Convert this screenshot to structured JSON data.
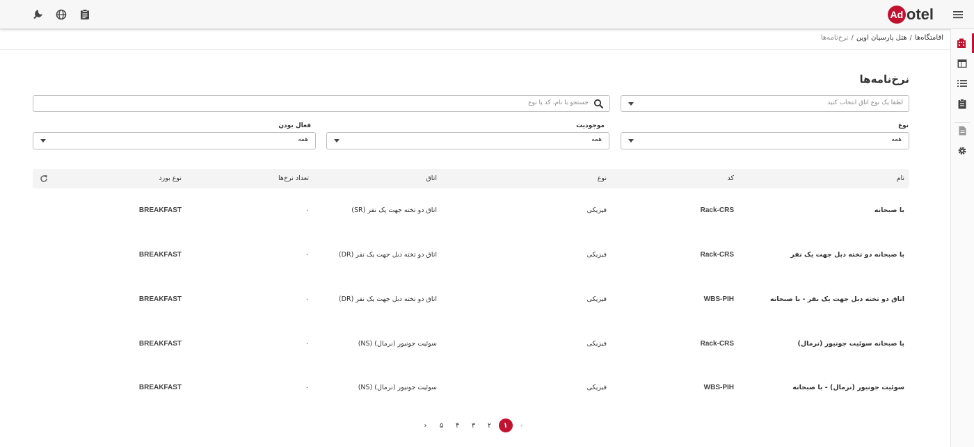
{
  "brand": {
    "name": "Adotel",
    "logo_mark": "Ad",
    "logo_rest": "otel",
    "accent": "#c1122f"
  },
  "topbar": {
    "icons": [
      "theme-toggle-icon",
      "globe-icon",
      "clipboard-icon"
    ],
    "menu_icon": "hamburger-menu-icon"
  },
  "sidebar": {
    "items": [
      "hotel-building-icon",
      "table-layout-icon",
      "list-icon",
      "clipboard-list-icon",
      "document-icon",
      "settings-gear-icon"
    ]
  },
  "breadcrumb": {
    "item1": "اقامتگاه‌ها",
    "sep": "/",
    "item2": "هتل پارسیان اوین",
    "current": "نرخ‌نامه‌ها"
  },
  "page_title": "نرخ‌نامه‌ها",
  "filters": {
    "room_type_placeholder": "لطفا یک نوع اتاق انتخاب کنید",
    "search_placeholder": "جستجو با نام، کد یا نوع",
    "type_label": "نوع",
    "type_value": "همه",
    "availability_label": "موجودیت",
    "availability_value": "همه",
    "active_label": "فعال بودن",
    "active_value": "همه"
  },
  "table": {
    "headers": {
      "name": "نام",
      "code": "کد",
      "type": "نوع",
      "room": "اتاق",
      "rate_count": "تعداد نرخ‌ها",
      "board_type": "نوع بورد"
    },
    "rows": [
      {
        "name": "با صبحانه",
        "code": "Rack-CRS",
        "type": "فیزیکی",
        "room": "اتاق دو تخته جهت یک نفر (SR)",
        "rate_count": "۰",
        "board_type": "BREAKFAST"
      },
      {
        "name": "با صبحانه دو تخته دبل جهت یک نفر",
        "code": "Rack-CRS",
        "type": "فیزیکی",
        "room": "اتاق دو تخته دبل جهت یک نفر (DR)",
        "rate_count": "۰",
        "board_type": "BREAKFAST"
      },
      {
        "name": "اتاق دو تخته دبل جهت یک نفر - با صبحانه",
        "code": "WBS-PIH",
        "type": "فیزیکی",
        "room": "اتاق دو تخته دبل جهت یک نفر (DR)",
        "rate_count": "۰",
        "board_type": "BREAKFAST"
      },
      {
        "name": "با صبحانه سوئیت جونیور (نرمال)",
        "code": "Rack-CRS",
        "type": "فیزیکی",
        "room": "سوئیت جونیور (نرمال) (NS)",
        "rate_count": "۰",
        "board_type": "BREAKFAST"
      },
      {
        "name": "سوئیت جونیور (نرمال) - با صبحانه",
        "code": "WBS-PIH",
        "type": "فیزیکی",
        "room": "سوئیت جونیور (نرمال) (NS)",
        "rate_count": "۰",
        "board_type": "BREAKFAST"
      }
    ]
  },
  "pagination": {
    "prev": "‹",
    "pages": [
      "۱",
      "۲",
      "۳",
      "۴",
      "۵"
    ],
    "next": "›",
    "current": "۱"
  }
}
